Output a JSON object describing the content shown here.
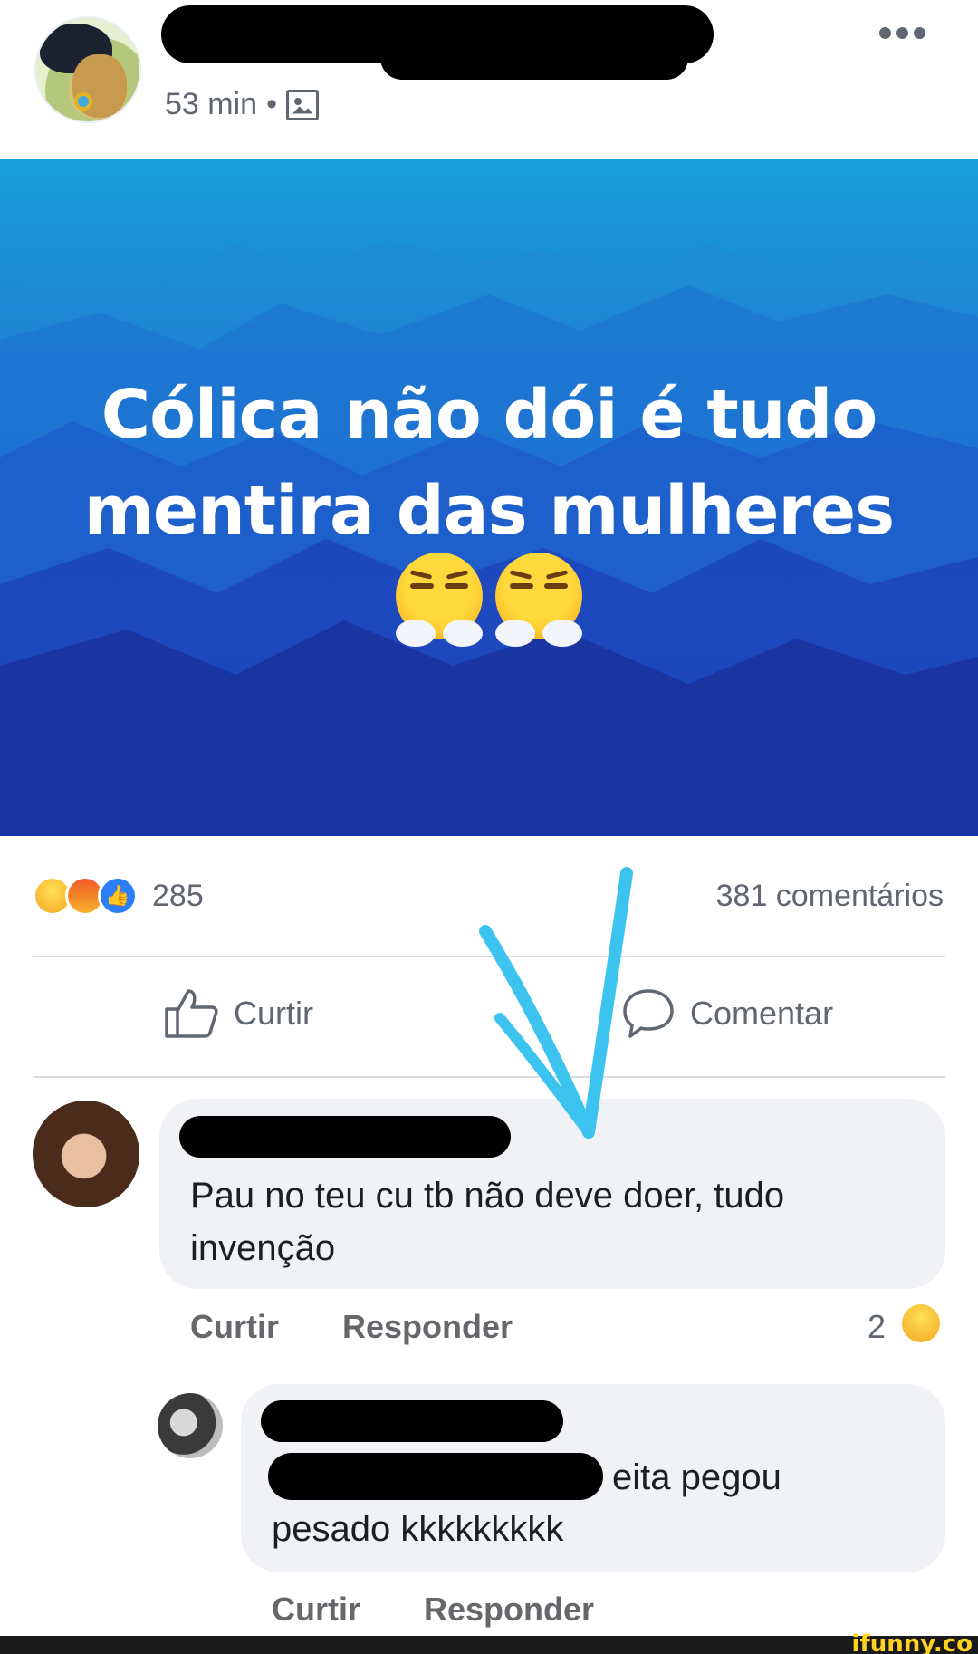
{
  "post": {
    "time": "53 min",
    "separator": "•",
    "text_line1": "Cólica não dói é tudo",
    "text_line2": "mentira das mulheres",
    "reaction_count": "285",
    "comment_count": "381 comentários"
  },
  "actions": {
    "like_label": "Curtir",
    "comment_label": "Comentar"
  },
  "comments": [
    {
      "text_line1": "Pau no teu cu tb não deve doer, tudo",
      "text_line2": "invenção",
      "like_label": "Curtir",
      "reply_label": "Responder",
      "reaction_count": "2"
    },
    {
      "text_line1": "eita pegou",
      "text_line2": "pesado kkkkkkkkk",
      "like_label": "Curtir",
      "reply_label": "Responder"
    }
  ],
  "watermark": "ifunny.co",
  "colors": {
    "arrow": "#3dc3ef",
    "muted_text": "#606770",
    "bubble": "#f0f2f5",
    "like_blue": "#2d7ff9"
  },
  "icons": [
    "more-icon",
    "photo-icon",
    "thumbs-up-icon",
    "speech-bubble-icon",
    "haha-reaction-icon",
    "angry-reaction-icon",
    "like-reaction-icon",
    "steam-nose-emoji-icon"
  ]
}
